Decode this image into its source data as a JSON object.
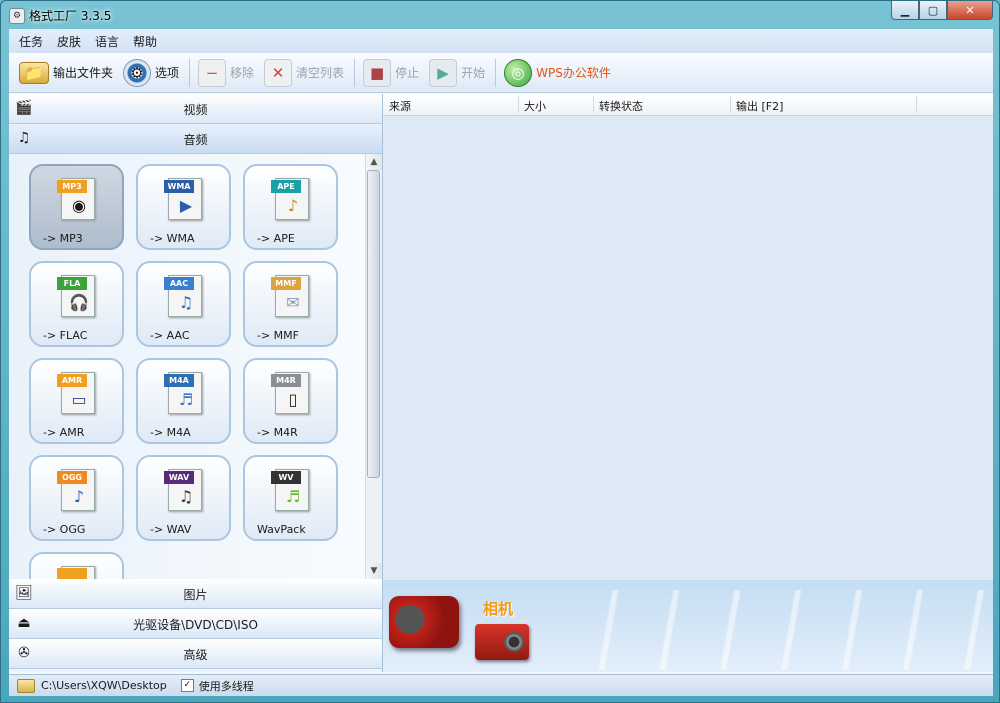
{
  "window": {
    "title": "格式工厂 3.3.5",
    "icon": "app-icon"
  },
  "menu": [
    "任务",
    "皮肤",
    "语言",
    "帮助"
  ],
  "toolbar": {
    "output_folder": "输出文件夹",
    "options": "选项",
    "remove": "移除",
    "clear_list": "清空列表",
    "stop": "停止",
    "start": "开始",
    "wps": "WPS办公软件"
  },
  "sections": {
    "video": "视频",
    "audio": "音频",
    "image": "图片",
    "optical": "光驱设备\\DVD\\CD\\ISO",
    "advanced": "高级"
  },
  "audio_formats": [
    {
      "tag": "MP3",
      "label": "-> MP3",
      "color": "#f0a020",
      "glyph": "◉"
    },
    {
      "tag": "WMA",
      "label": "-> WMA",
      "color": "#2a5fa8",
      "glyph": "▶"
    },
    {
      "tag": "APE",
      "label": "-> APE",
      "color": "#1aa0a8",
      "glyph": "♪"
    },
    {
      "tag": "FLA",
      "label": "-> FLAC",
      "color": "#3aa33a",
      "glyph": "🎧"
    },
    {
      "tag": "AAC",
      "label": "-> AAC",
      "color": "#3b7fd0",
      "glyph": "♫"
    },
    {
      "tag": "MMF",
      "label": "-> MMF",
      "color": "#d9a441",
      "glyph": "✉"
    },
    {
      "tag": "AMR",
      "label": "-> AMR",
      "color": "#f0a020",
      "glyph": "▭"
    },
    {
      "tag": "M4A",
      "label": "-> M4A",
      "color": "#2f6fb3",
      "glyph": "♬"
    },
    {
      "tag": "M4R",
      "label": "-> M4R",
      "color": "#8a8f96",
      "glyph": "▯"
    },
    {
      "tag": "OGG",
      "label": "-> OGG",
      "color": "#f08a20",
      "glyph": "♪"
    },
    {
      "tag": "WAV",
      "label": "-> WAV",
      "color": "#5a2a7a",
      "glyph": "♫"
    },
    {
      "tag": "WV",
      "label": "WavPack",
      "color": "#333333",
      "glyph": "♬"
    }
  ],
  "list_columns": [
    "来源",
    "大小",
    "转换状态",
    "输出 [F2]"
  ],
  "banner": {
    "camera_label": "相机"
  },
  "status": {
    "path": "C:\\Users\\XQW\\Desktop",
    "multithread": "使用多线程",
    "multithread_checked": true
  }
}
